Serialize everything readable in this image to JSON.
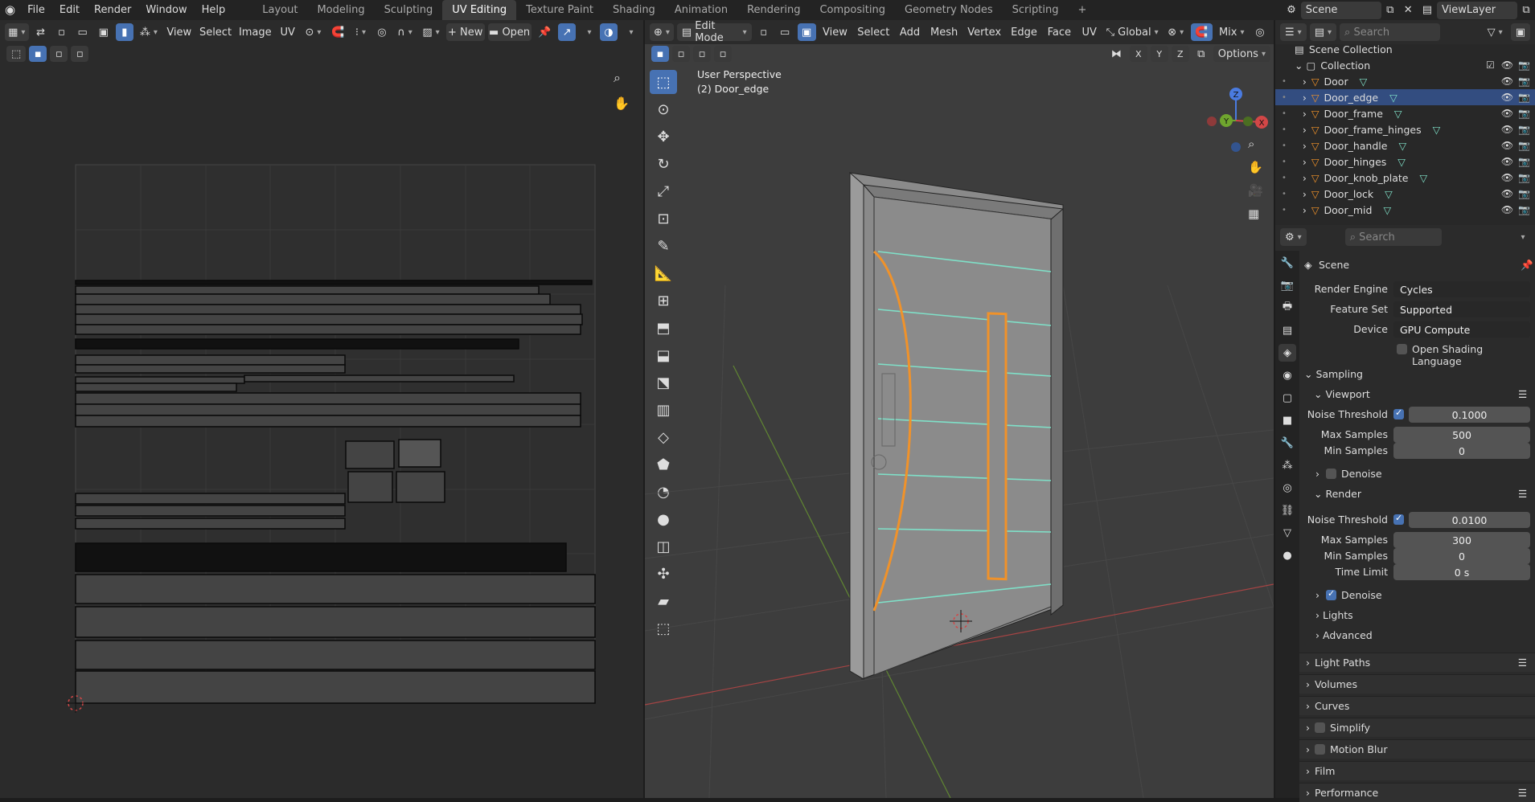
{
  "topbar": {
    "menus": [
      "File",
      "Edit",
      "Render",
      "Window",
      "Help"
    ],
    "workspaces": [
      "Layout",
      "Modeling",
      "Sculpting",
      "UV Editing",
      "Texture Paint",
      "Shading",
      "Animation",
      "Rendering",
      "Compositing",
      "Geometry Nodes",
      "Scripting"
    ],
    "active_workspace": "UV Editing",
    "add_workspace": "+",
    "scene": "Scene",
    "viewlayer": "ViewLayer"
  },
  "uv_header": {
    "menus": [
      "View",
      "Select",
      "Image",
      "UV"
    ],
    "new_label": "New",
    "open_label": "Open"
  },
  "viewport_header": {
    "mode": "Edit Mode",
    "menus": [
      "View",
      "Select",
      "Add",
      "Mesh",
      "Vertex",
      "Edge",
      "Face",
      "UV"
    ],
    "orientation": "Global",
    "pivot": "Mix",
    "options": "Options",
    "axes": [
      "X",
      "Y",
      "Z"
    ]
  },
  "viewport": {
    "view_name": "User Perspective",
    "object_name": "(2) Door_edge",
    "gizmo": {
      "z": "Z",
      "y": "Y",
      "x": "X"
    }
  },
  "outliner": {
    "search_placeholder": "Search",
    "root": "Scene Collection",
    "collection": "Collection",
    "objects": [
      "Door",
      "Door_edge",
      "Door_frame",
      "Door_frame_hinges",
      "Door_handle",
      "Door_hinges",
      "Door_knob_plate",
      "Door_lock",
      "Door_mid"
    ],
    "selected": "Door_edge"
  },
  "properties": {
    "search_placeholder": "Search",
    "context": "Scene",
    "render_engine_label": "Render Engine",
    "render_engine": "Cycles",
    "feature_set_label": "Feature Set",
    "feature_set": "Supported",
    "device_label": "Device",
    "device": "GPU Compute",
    "osl_label": "Open Shading Language",
    "sampling": "Sampling",
    "viewport": "Viewport",
    "vp_noise_label": "Noise Threshold",
    "vp_noise": "0.1000",
    "vp_max_label": "Max Samples",
    "vp_max": "500",
    "vp_min_label": "Min Samples",
    "vp_min": "0",
    "denoise": "Denoise",
    "render": "Render",
    "r_noise_label": "Noise Threshold",
    "r_noise": "0.0100",
    "r_max_label": "Max Samples",
    "r_max": "300",
    "r_min_label": "Min Samples",
    "r_min": "0",
    "r_time_label": "Time Limit",
    "r_time": "0 s",
    "r_denoise": "Denoise",
    "lights": "Lights",
    "advanced": "Advanced",
    "panels": [
      "Light Paths",
      "Volumes",
      "Curves",
      "Simplify",
      "Motion Blur",
      "Film",
      "Performance"
    ]
  },
  "colors": {
    "accent": "#4772b3",
    "selection_orange": "#f0922a",
    "teal": "#7fe0c8",
    "axis_red": "#d24747",
    "axis_green": "#6fa52e"
  }
}
